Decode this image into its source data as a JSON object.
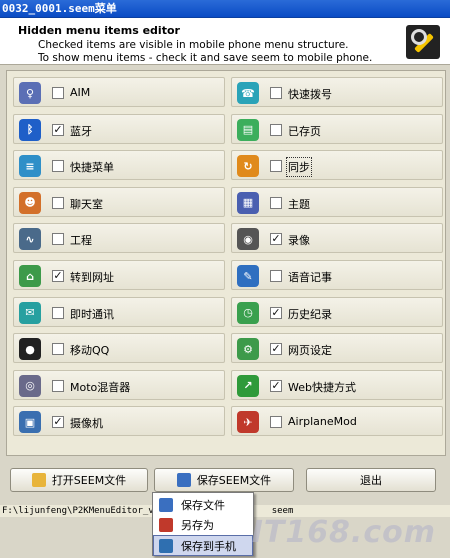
{
  "window": {
    "title": "0032_0001.seem菜单"
  },
  "header": {
    "title": "Hidden menu items editor",
    "line1": "Checked items are visible in mobile phone menu structure.",
    "line2": "To show menu items - check it and save seem to mobile phone.",
    "icon": "tools-icon"
  },
  "items": [
    {
      "label": "AIM",
      "checked": false,
      "icon": "aim-icon",
      "color": "#5b6fb5",
      "glyph": "♀"
    },
    {
      "label": "快速拨号",
      "checked": false,
      "icon": "speed-dial-icon",
      "color": "#2aa3b8",
      "glyph": "☎"
    },
    {
      "label": "蓝牙",
      "checked": true,
      "icon": "bluetooth-icon",
      "color": "#1f5fc8",
      "glyph": "ᛒ"
    },
    {
      "label": "已存页",
      "checked": false,
      "icon": "saved-pages-icon",
      "color": "#3cae5c",
      "glyph": "▤"
    },
    {
      "label": "快捷菜单",
      "checked": false,
      "icon": "shortcut-menu-icon",
      "color": "#2f8fc8",
      "glyph": "≡"
    },
    {
      "label": "同步",
      "checked": false,
      "icon": "sync-icon",
      "color": "#e08a1c",
      "glyph": "↻"
    },
    {
      "label": "聊天室",
      "checked": false,
      "icon": "chat-room-icon",
      "color": "#d3702a",
      "glyph": "☻"
    },
    {
      "label": "主题",
      "checked": false,
      "icon": "theme-icon",
      "color": "#4a5fb0",
      "glyph": "▦"
    },
    {
      "label": "工程",
      "checked": false,
      "icon": "engineering-icon",
      "color": "#4a6a8a",
      "glyph": "∿"
    },
    {
      "label": "录像",
      "checked": true,
      "icon": "video-record-icon",
      "color": "#555555",
      "glyph": "◉"
    },
    {
      "label": "转到网址",
      "checked": true,
      "icon": "goto-url-icon",
      "color": "#3d9a4a",
      "glyph": "⌂"
    },
    {
      "label": "语音记事",
      "checked": false,
      "icon": "voice-note-icon",
      "color": "#2f6fc0",
      "glyph": "✎"
    },
    {
      "label": "即时通讯",
      "checked": false,
      "icon": "instant-messaging-icon",
      "color": "#27a0a0",
      "glyph": "✉"
    },
    {
      "label": "历史纪录",
      "checked": true,
      "icon": "history-icon",
      "color": "#3aa04e",
      "glyph": "◷"
    },
    {
      "label": "移动QQ",
      "checked": false,
      "icon": "qq-icon",
      "color": "#222222",
      "glyph": "●"
    },
    {
      "label": "网页设定",
      "checked": true,
      "icon": "web-settings-icon",
      "color": "#3d9a4a",
      "glyph": "⚙"
    },
    {
      "label": "Moto混音器",
      "checked": false,
      "icon": "mixer-icon",
      "color": "#6a6a8a",
      "glyph": "◎"
    },
    {
      "label": "Web快捷方式",
      "checked": true,
      "icon": "web-shortcut-icon",
      "color": "#2f9a3a",
      "glyph": "↗"
    },
    {
      "label": "摄像机",
      "checked": true,
      "icon": "camera-icon",
      "color": "#3a6fb0",
      "glyph": "▣"
    },
    {
      "label": "AirplaneMod",
      "checked": false,
      "icon": "airplane-mode-icon",
      "color": "#c0392b",
      "glyph": "✈"
    }
  ],
  "buttons": {
    "open": "打开SEEM文件",
    "save": "保存SEEM文件",
    "exit": "退出"
  },
  "statusbar": {
    "path": "F:\\lijunfeng\\P2KMenuEditor_v",
    "suffix": "seem"
  },
  "context_menu": {
    "items": [
      {
        "label": "保存文件",
        "icon": "save-file-icon"
      },
      {
        "label": "另存为",
        "icon": "save-as-icon"
      },
      {
        "label": "保存到手机",
        "icon": "save-to-phone-icon"
      }
    ]
  },
  "watermark": "IT168.com"
}
